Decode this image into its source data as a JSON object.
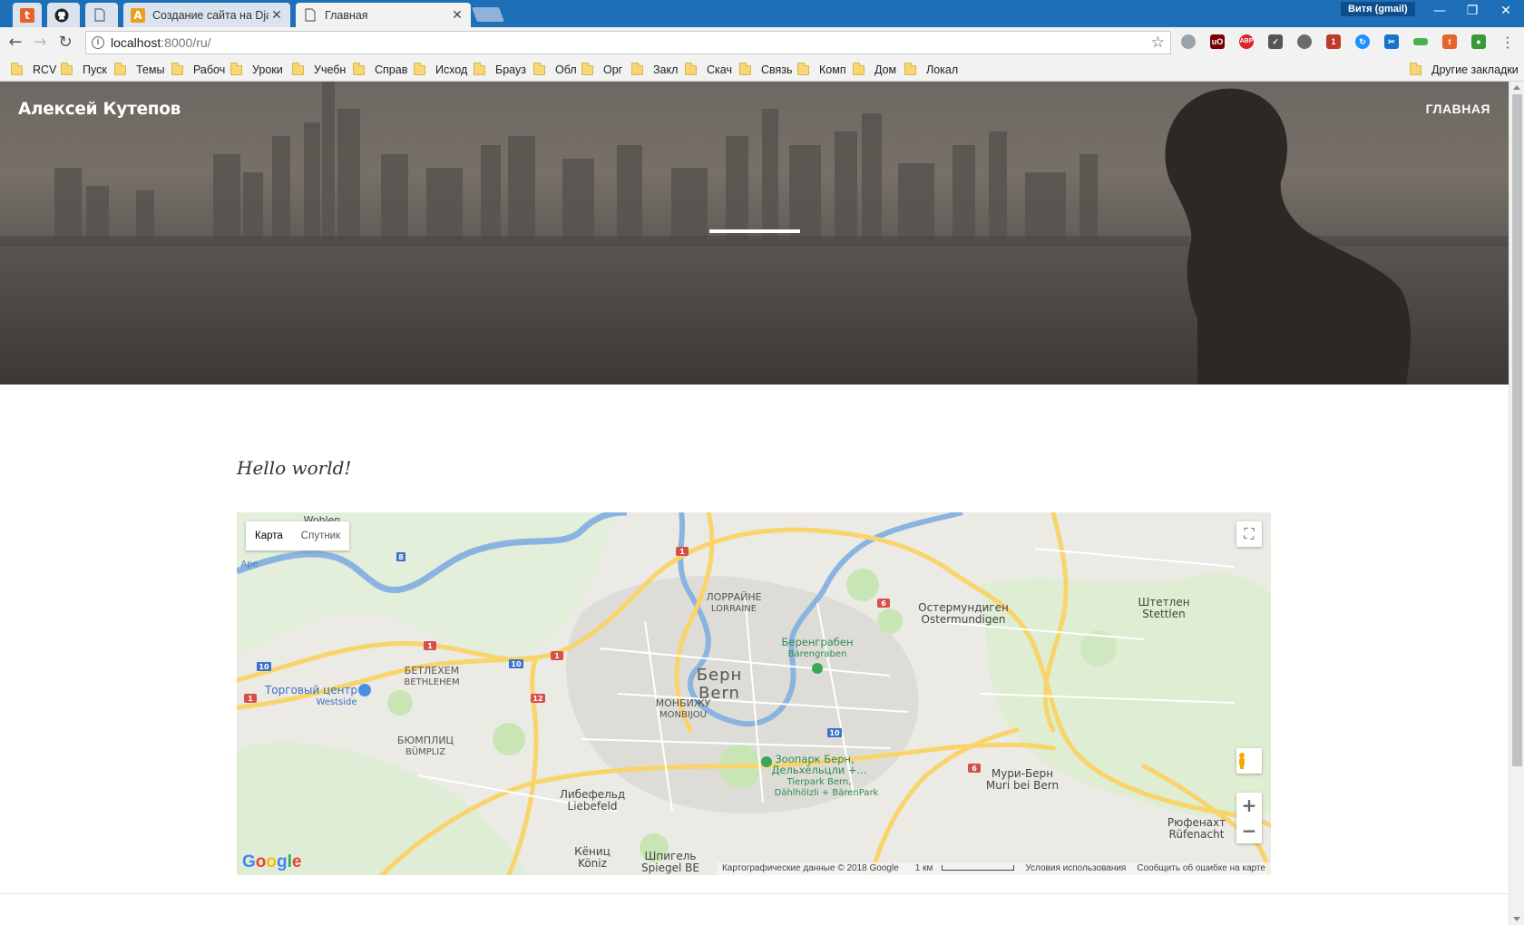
{
  "browser": {
    "tabs": [
      {
        "favicon": "t",
        "color": "#e8622c",
        "label": ""
      },
      {
        "favicon": "github-icon",
        "label": ""
      },
      {
        "favicon": "page-icon",
        "label": ""
      },
      {
        "favicon": "A",
        "color": "#e8a11c",
        "label": "Создание сайта на Djan"
      },
      {
        "favicon": "page-icon",
        "label": "Главная"
      }
    ],
    "profile_name": "Витя (gmail)",
    "url_host": "localhost",
    "url_rest": ":8000/ru/",
    "bookmarks": [
      "RCV",
      "Пуск",
      "Темы",
      "Рабоч",
      "Уроки",
      "Учебн",
      "Справ",
      "Исход",
      "Брауз",
      "Обл",
      "Орг",
      "Закл",
      "Скач",
      "Связь",
      "Комп",
      "Дом",
      "Локал"
    ],
    "other_bookmarks": "Другие закладки",
    "ext_badge": "1"
  },
  "site": {
    "brand": "Алексей Кутепов",
    "nav_home": "ГЛАВНАЯ",
    "content_text": "Hello world!"
  },
  "map": {
    "type_map": "Карта",
    "type_satellite": "Спутник",
    "footer": {
      "data": "Картографические данные © 2018 Google",
      "scale": "1 км",
      "terms": "Условия использования",
      "report": "Сообщить об ошибке на карте"
    },
    "google": "Google",
    "labels": [
      {
        "ru": "Берн",
        "de": "Bern"
      },
      {
        "ru": "ЛОРРАЙНЕ",
        "de": "LORRAINE"
      },
      {
        "ru": "Беренграбен",
        "de": "Bärengraben"
      },
      {
        "ru": "Остермундиген",
        "de": "Ostermundigen"
      },
      {
        "ru": "Штетлен",
        "de": "Stettlen"
      },
      {
        "ru": "БЕТЛЕХЕМ",
        "de": "BETHLEHEM"
      },
      {
        "ru": "Торговый центр",
        "de": "Westside"
      },
      {
        "ru": "МОНБИЖУ",
        "de": "MONBIJOU"
      },
      {
        "ru": "БЮМПЛИЦ",
        "de": "BÜMPLIZ"
      },
      {
        "ru": "Зоопарк Берн,",
        "de": "Дельхёльцли +..."
      },
      {
        "ru": "Tierpark Bern,",
        "de": "Dählhölzli + BärenPark"
      },
      {
        "ru": "Либефельд",
        "de": "Liebefeld"
      },
      {
        "ru": "Мури-Берн",
        "de": "Muri bei Bern"
      },
      {
        "ru": "Рюфенахт",
        "de": "Rüfenacht"
      },
      {
        "ru": "Кёниц",
        "de": "Köniz"
      },
      {
        "ru": "Шпигель",
        "de": "Spiegel BE"
      },
      {
        "ru": "Wohlen",
        "de": ""
      },
      {
        "ru": "Аре",
        "de": ""
      }
    ],
    "road_badges": [
      "1",
      "1",
      "1",
      "1",
      "6",
      "6",
      "8",
      "10",
      "10",
      "10",
      "12"
    ]
  },
  "colors": {
    "titlebar": "#1d6fb7",
    "map_road": "#f9d46b",
    "map_river": "#8ab4e0",
    "map_green": "#c8e6b5"
  }
}
